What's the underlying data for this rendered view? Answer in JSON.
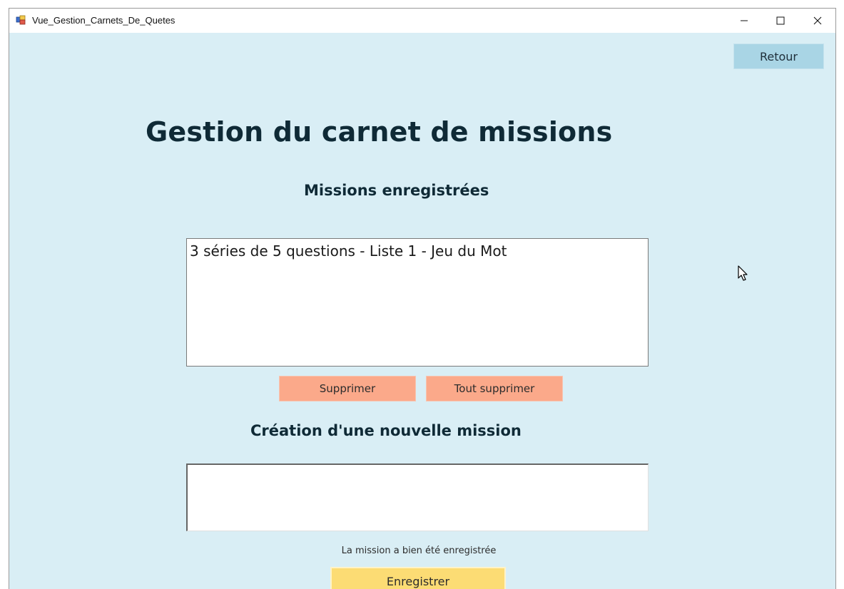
{
  "window": {
    "title": "Vue_Gestion_Carnets_De_Quetes",
    "icon": "windows-form-icon"
  },
  "header": {
    "back_button_label": "Retour",
    "page_title": "Gestion du carnet de missions"
  },
  "saved_missions": {
    "section_title": "Missions enregistrées",
    "items": [
      {
        "label": "3 séries de 5 questions - Liste 1 - Jeu du Mot"
      }
    ],
    "delete_label": "Supprimer",
    "delete_all_label": "Tout supprimer"
  },
  "new_mission": {
    "section_title": "Création d'une nouvelle mission",
    "input_value": "",
    "status_message": "La mission a bien été enregistrée",
    "save_label": "Enregistrer"
  },
  "colors": {
    "background": "#d9eef5",
    "back_button": "#a9d5e5",
    "delete_buttons": "#fba98a",
    "save_button": "#fcdc74",
    "title_text": "#0f2a36"
  }
}
